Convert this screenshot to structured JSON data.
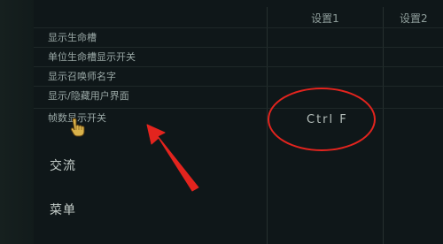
{
  "columns": {
    "setting1": "设置1",
    "setting2": "设置2"
  },
  "rows": [
    {
      "label": "显示生命槽",
      "setting1": ""
    },
    {
      "label": "单位生命槽显示开关",
      "setting1": ""
    },
    {
      "label": "显示召唤师名字",
      "setting1": ""
    },
    {
      "label": "显示/隐藏用户界面",
      "setting1": ""
    },
    {
      "label": "帧数显示开关",
      "setting1": "Ctrl  F"
    }
  ],
  "sections": [
    {
      "label": "交流"
    },
    {
      "label": "菜单"
    }
  ],
  "annotation": {
    "highlight_color": "#e3241e",
    "icons": [
      "pointing-hand-cursor-icon",
      "red-arrow-icon"
    ]
  }
}
